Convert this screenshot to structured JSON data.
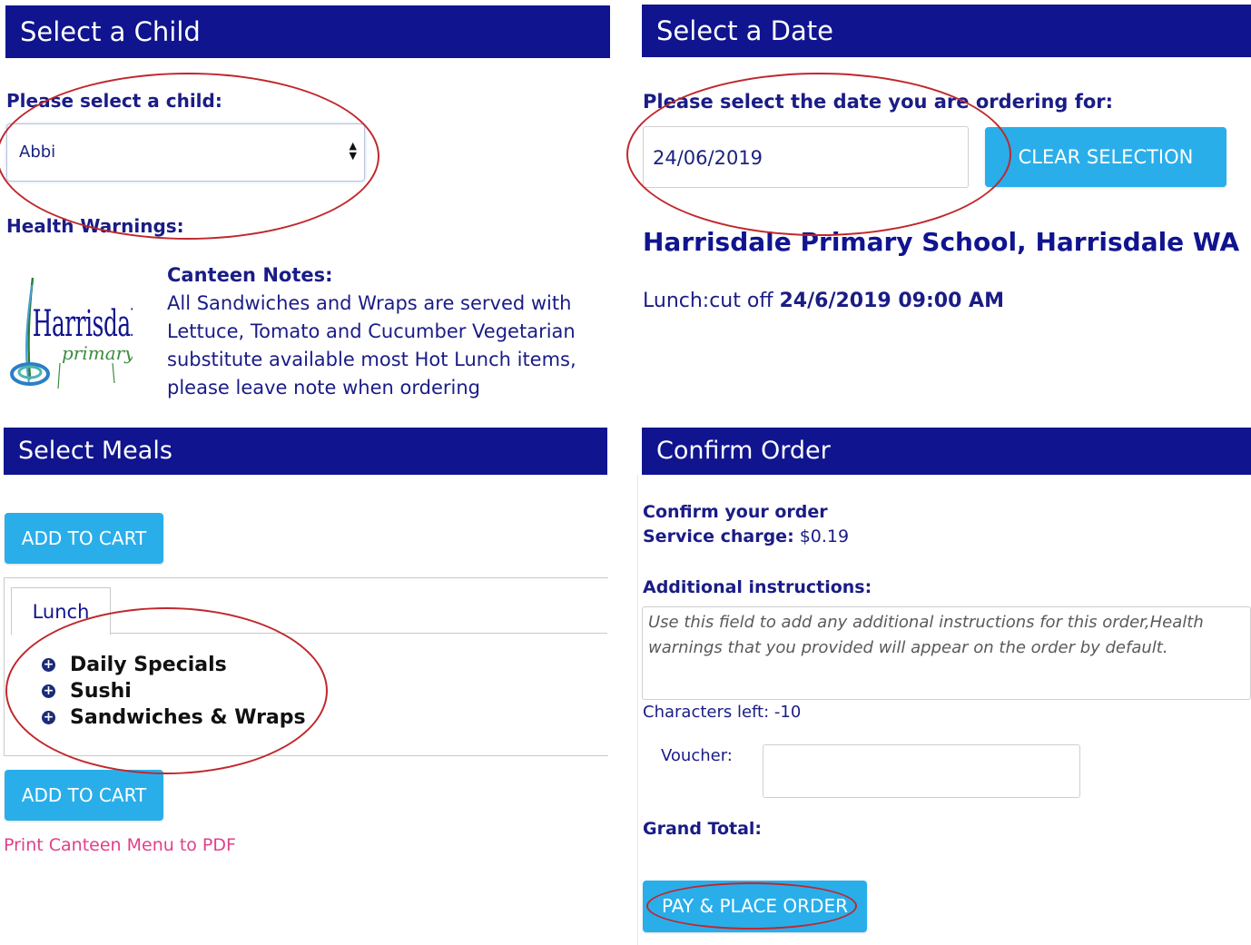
{
  "select_child": {
    "header": "Select a Child",
    "prompt": "Please select a child:",
    "selected_child": "Abbi",
    "health_warnings_label": "Health Warnings:",
    "logo_text_main": "Harrisdale",
    "logo_text_sub": "primary",
    "canteen_notes_title": "Canteen Notes:",
    "canteen_notes_text": "All Sandwiches and Wraps are served with Lettuce, Tomato and Cucumber Vegetarian substitute available most Hot Lunch items, please leave note when ordering"
  },
  "select_date": {
    "header": "Select a Date",
    "prompt": "Please select the date you are ordering for:",
    "date_value": "24/06/2019",
    "clear_button": "CLEAR SELECTION",
    "school_name": "Harrisdale Primary School, Harrisdale WA",
    "cutoff_label": "Lunch:cut off ",
    "cutoff_value": "24/6/2019 09:00 AM"
  },
  "select_meals": {
    "header": "Select Meals",
    "add_to_cart_top": "ADD TO CART",
    "tab_label": "Lunch",
    "categories": [
      "Daily Specials",
      "Sushi",
      "Sandwiches & Wraps"
    ],
    "add_to_cart_bottom": "ADD TO CART",
    "print_link": "Print Canteen Menu to PDF"
  },
  "confirm_order": {
    "header": "Confirm Order",
    "confirm_label": "Confirm your order",
    "service_charge_label": "Service charge:",
    "service_charge_value": " $0.19",
    "additional_label": "Additional instructions:",
    "instructions_placeholder": "Use this field to add any additional instructions for this order,Health warnings that you provided will appear on the order by default.",
    "chars_left": "Characters left: -10",
    "voucher_label": "Voucher:",
    "grand_total_label": "Grand Total:",
    "pay_button": "PAY & PLACE ORDER"
  },
  "colors": {
    "header_bg": "#10148f",
    "button_bg": "#29aeea",
    "link": "#e0408a",
    "annotation": "#c0282d"
  }
}
